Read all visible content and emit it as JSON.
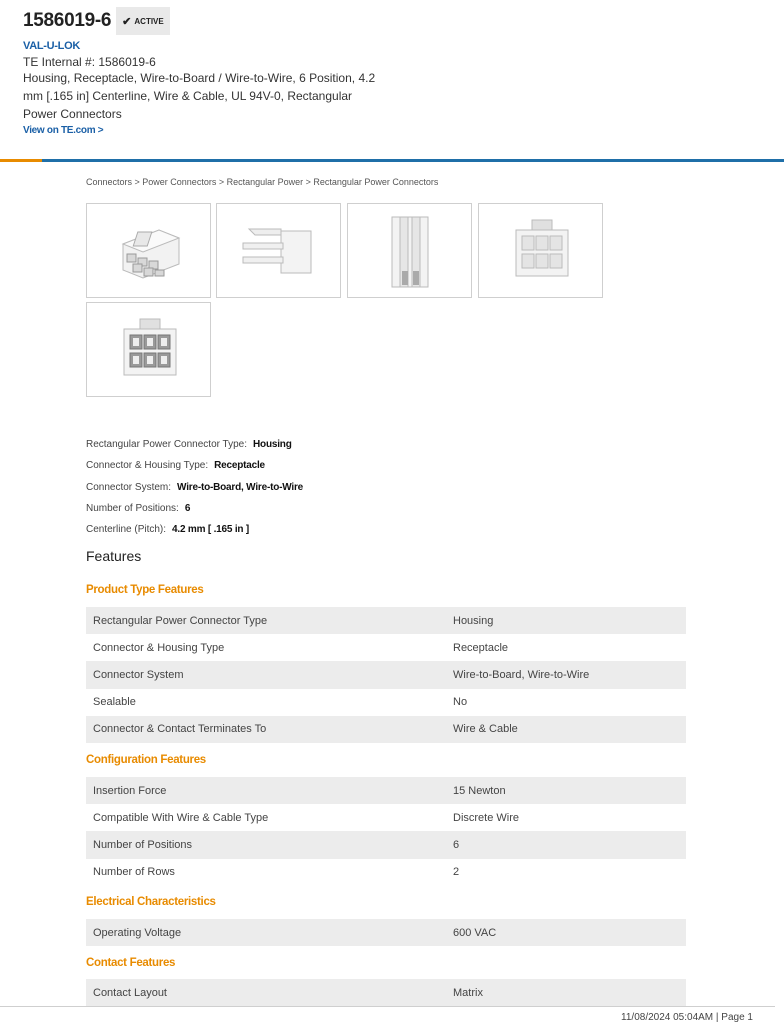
{
  "header": {
    "part_number": "1586019-6",
    "status": "ACTIVE",
    "brand": "VAL-U-LOK",
    "te_internal": "TE Internal #: 1586019-6",
    "description": "Housing, Receptacle, Wire-to-Board / Wire-to-Wire, 6 Position, 4.2 mm [.165 in] Centerline, Wire & Cable, UL 94V-0, Rectangular Power Connectors",
    "view_link": "View on TE.com >"
  },
  "colors": {
    "accent_orange": "#e88b00",
    "rule_blue": "#1f6fa8",
    "link_blue": "#1a5fa6"
  },
  "breadcrumb": "Connectors > Power Connectors > Rectangular Power > Rectangular Power Connectors",
  "thumbnails": [
    "connector-iso-image",
    "connector-side-image",
    "connector-top-image",
    "connector-front-image",
    "connector-rear-image"
  ],
  "key_specs": [
    {
      "label": "Rectangular Power Connector Type:",
      "value": "Housing"
    },
    {
      "label": "Connector & Housing Type:",
      "value": "Receptacle"
    },
    {
      "label": "Connector System:",
      "value": "Wire-to-Board, Wire-to-Wire"
    },
    {
      "label": "Number of Positions:",
      "value": "6"
    },
    {
      "label": "Centerline (Pitch):",
      "value": "4.2 mm [ .165 in ]"
    }
  ],
  "features_heading": "Features",
  "sections": [
    {
      "title": "Product Type Features",
      "rows": [
        {
          "name": "Rectangular Power Connector Type",
          "value": "Housing"
        },
        {
          "name": "Connector & Housing Type",
          "value": "Receptacle"
        },
        {
          "name": "Connector System",
          "value": "Wire-to-Board, Wire-to-Wire"
        },
        {
          "name": "Sealable",
          "value": "No"
        },
        {
          "name": "Connector & Contact Terminates To",
          "value": "Wire & Cable"
        }
      ]
    },
    {
      "title": "Configuration Features",
      "rows": [
        {
          "name": "Insertion Force",
          "value": "15 Newton"
        },
        {
          "name": "Compatible With Wire & Cable Type",
          "value": "Discrete Wire"
        },
        {
          "name": "Number of Positions",
          "value": "6"
        },
        {
          "name": "Number of Rows",
          "value": "2"
        }
      ]
    },
    {
      "title": "Electrical Characteristics",
      "rows": [
        {
          "name": "Operating Voltage",
          "value": "600 VAC"
        }
      ]
    },
    {
      "title": "Contact Features",
      "rows": [
        {
          "name": "Contact Layout",
          "value": "Matrix"
        }
      ]
    }
  ],
  "footer": "11/08/2024 05:04AM | Page 1"
}
